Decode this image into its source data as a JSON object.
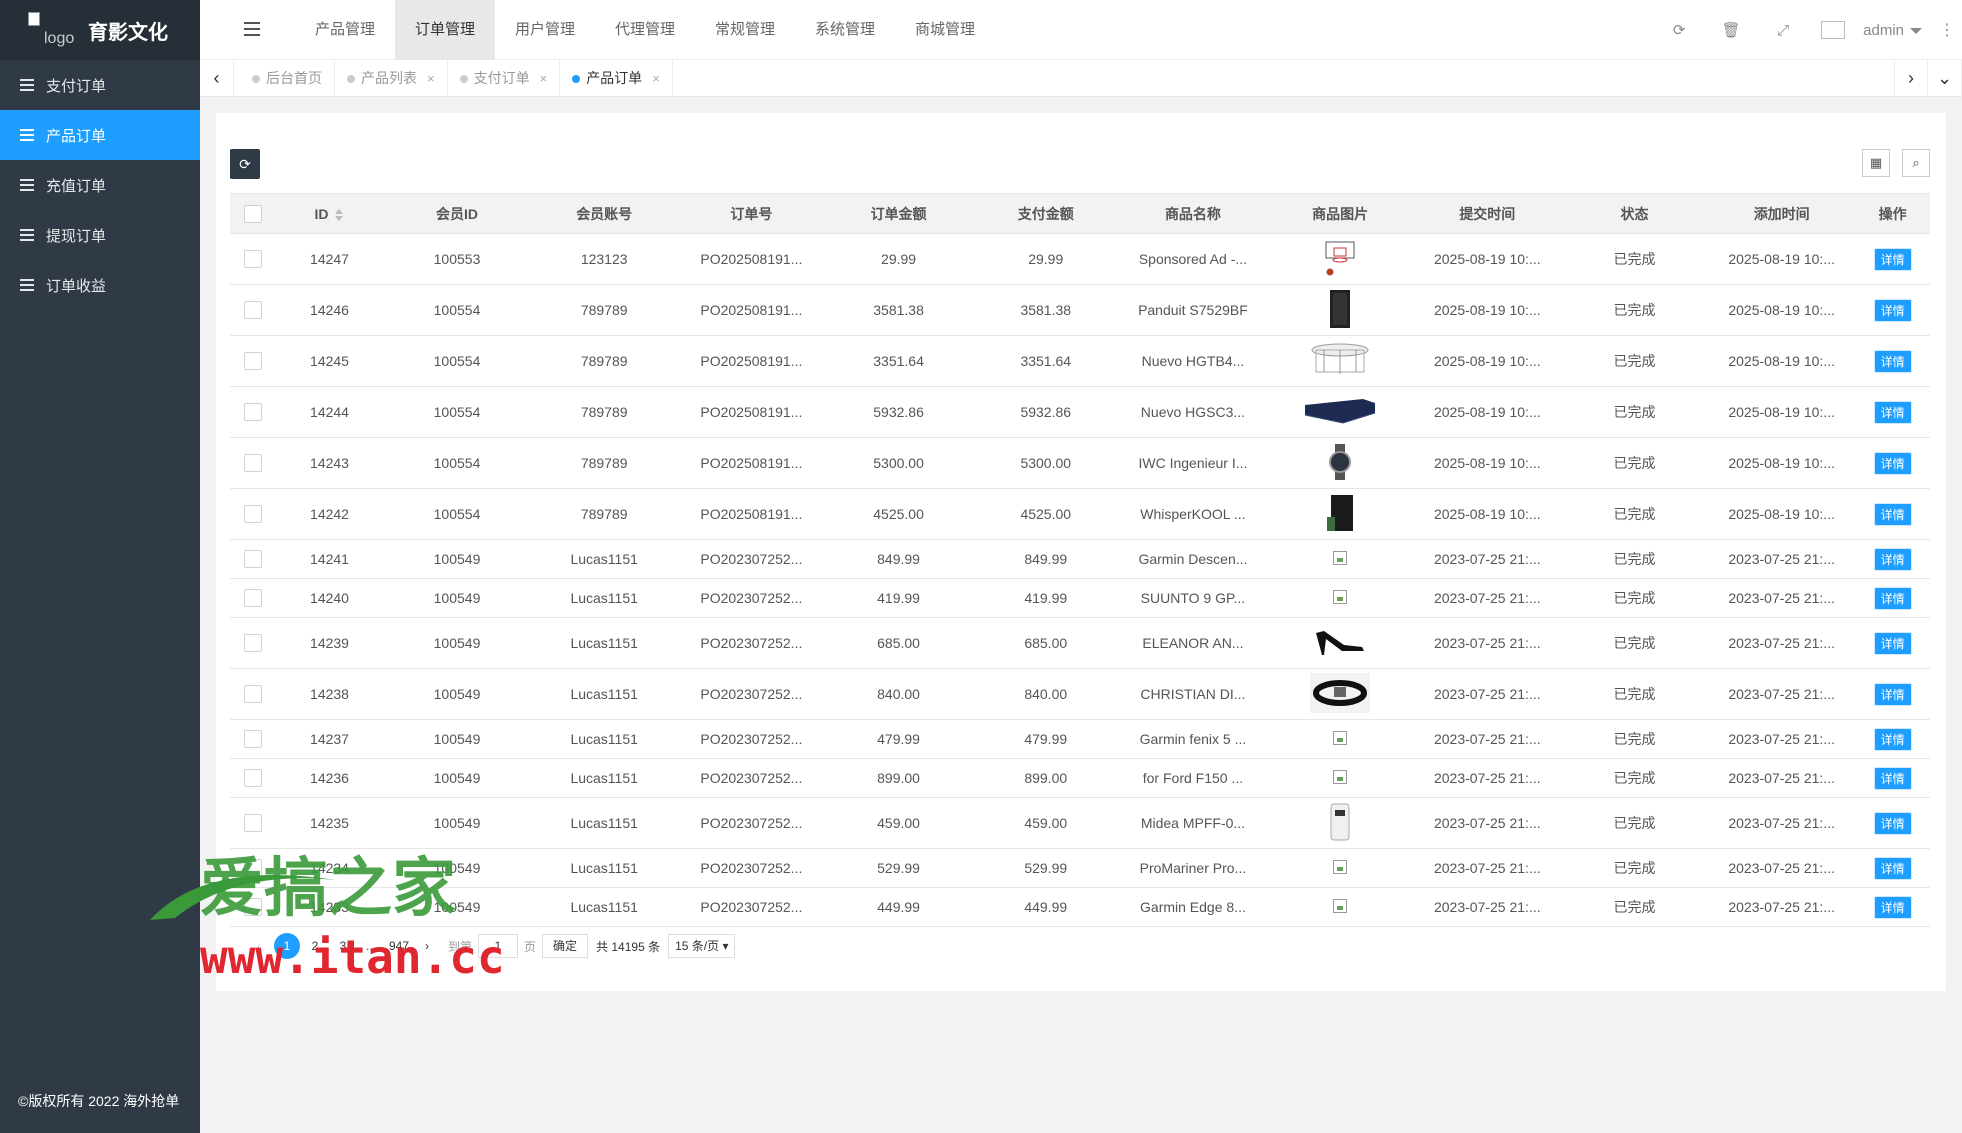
{
  "brand": {
    "logo_alt": "logo",
    "name": "育影文化"
  },
  "sidebar": {
    "items": [
      {
        "label": "支付订单",
        "active": false
      },
      {
        "label": "产品订单",
        "active": true
      },
      {
        "label": "充值订单",
        "active": false
      },
      {
        "label": "提现订单",
        "active": false
      },
      {
        "label": "订单收益",
        "active": false
      }
    ],
    "copyright": "©版权所有 2022 海外抢单"
  },
  "topnav": {
    "items": [
      "产品管理",
      "订单管理",
      "用户管理",
      "代理管理",
      "常规管理",
      "系统管理",
      "商城管理"
    ],
    "active_index": 1
  },
  "header": {
    "user": "admin"
  },
  "tabs": [
    {
      "label": "后台首页",
      "closable": false
    },
    {
      "label": "产品列表",
      "closable": true
    },
    {
      "label": "支付订单",
      "closable": true
    },
    {
      "label": "产品订单",
      "closable": true,
      "active": true
    }
  ],
  "table": {
    "columns": [
      "ID",
      "会员ID",
      "会员账号",
      "订单号",
      "订单金额",
      "支付金额",
      "商品名称",
      "商品图片",
      "提交时间",
      "状态",
      "添加时间",
      "操作"
    ],
    "detail_label": "详情",
    "rows": [
      {
        "id": "14247",
        "member_id": "100553",
        "account": "123123",
        "order_no": "PO202508191...",
        "amount": "29.99",
        "paid": "29.99",
        "product": "Sponsored Ad -...",
        "image": "hoop",
        "submitted": "2025-08-19 10:...",
        "status": "已完成",
        "added": "2025-08-19 10:..."
      },
      {
        "id": "14246",
        "member_id": "100554",
        "account": "789789",
        "order_no": "PO202508191...",
        "amount": "3581.38",
        "paid": "3581.38",
        "product": "Panduit S7529BF",
        "image": "cabinet",
        "submitted": "2025-08-19 10:...",
        "status": "已完成",
        "added": "2025-08-19 10:..."
      },
      {
        "id": "14245",
        "member_id": "100554",
        "account": "789789",
        "order_no": "PO202508191...",
        "amount": "3351.64",
        "paid": "3351.64",
        "product": "Nuevo HGTB4...",
        "image": "table",
        "submitted": "2025-08-19 10:...",
        "status": "已完成",
        "added": "2025-08-19 10:..."
      },
      {
        "id": "14244",
        "member_id": "100554",
        "account": "789789",
        "order_no": "PO202508191...",
        "amount": "5932.86",
        "paid": "5932.86",
        "product": "Nuevo HGSC3...",
        "image": "sofa",
        "submitted": "2025-08-19 10:...",
        "status": "已完成",
        "added": "2025-08-19 10:..."
      },
      {
        "id": "14243",
        "member_id": "100554",
        "account": "789789",
        "order_no": "PO202508191...",
        "amount": "5300.00",
        "paid": "5300.00",
        "product": "IWC Ingenieur I...",
        "image": "watch",
        "submitted": "2025-08-19 10:...",
        "status": "已完成",
        "added": "2025-08-19 10:..."
      },
      {
        "id": "14242",
        "member_id": "100554",
        "account": "789789",
        "order_no": "PO202508191...",
        "amount": "4525.00",
        "paid": "4525.00",
        "product": "WhisperKOOL ...",
        "image": "cooler",
        "submitted": "2025-08-19 10:...",
        "status": "已完成",
        "added": "2025-08-19 10:..."
      },
      {
        "id": "14241",
        "member_id": "100549",
        "account": "Lucas1151",
        "order_no": "PO202307252...",
        "amount": "849.99",
        "paid": "849.99",
        "product": "Garmin Descen...",
        "image": "broken",
        "submitted": "2023-07-25 21:...",
        "status": "已完成",
        "added": "2023-07-25 21:..."
      },
      {
        "id": "14240",
        "member_id": "100549",
        "account": "Lucas1151",
        "order_no": "PO202307252...",
        "amount": "419.99",
        "paid": "419.99",
        "product": "SUUNTO 9 GP...",
        "image": "broken",
        "submitted": "2023-07-25 21:...",
        "status": "已完成",
        "added": "2023-07-25 21:..."
      },
      {
        "id": "14239",
        "member_id": "100549",
        "account": "Lucas1151",
        "order_no": "PO202307252...",
        "amount": "685.00",
        "paid": "685.00",
        "product": "ELEANOR AN...",
        "image": "heels",
        "submitted": "2023-07-25 21:...",
        "status": "已完成",
        "added": "2023-07-25 21:..."
      },
      {
        "id": "14238",
        "member_id": "100549",
        "account": "Lucas1151",
        "order_no": "PO202307252...",
        "amount": "840.00",
        "paid": "840.00",
        "product": "CHRISTIAN DI...",
        "image": "belt",
        "submitted": "2023-07-25 21:...",
        "status": "已完成",
        "added": "2023-07-25 21:..."
      },
      {
        "id": "14237",
        "member_id": "100549",
        "account": "Lucas1151",
        "order_no": "PO202307252...",
        "amount": "479.99",
        "paid": "479.99",
        "product": "Garmin fenix 5 ...",
        "image": "broken",
        "submitted": "2023-07-25 21:...",
        "status": "已完成",
        "added": "2023-07-25 21:..."
      },
      {
        "id": "14236",
        "member_id": "100549",
        "account": "Lucas1151",
        "order_no": "PO202307252...",
        "amount": "899.00",
        "paid": "899.00",
        "product": "for Ford F150 ...",
        "image": "broken",
        "submitted": "2023-07-25 21:...",
        "status": "已完成",
        "added": "2023-07-25 21:..."
      },
      {
        "id": "14235",
        "member_id": "100549",
        "account": "Lucas1151",
        "order_no": "PO202307252...",
        "amount": "459.00",
        "paid": "459.00",
        "product": "Midea MPFF-0...",
        "image": "ac",
        "submitted": "2023-07-25 21:...",
        "status": "已完成",
        "added": "2023-07-25 21:..."
      },
      {
        "id": "14234",
        "member_id": "100549",
        "account": "Lucas1151",
        "order_no": "PO202307252...",
        "amount": "529.99",
        "paid": "529.99",
        "product": "ProMariner Pro...",
        "image": "broken",
        "submitted": "2023-07-25 21:...",
        "status": "已完成",
        "added": "2023-07-25 21:..."
      },
      {
        "id": "14233",
        "member_id": "100549",
        "account": "Lucas1151",
        "order_no": "PO202307252...",
        "amount": "449.99",
        "paid": "449.99",
        "product": "Garmin Edge 8...",
        "image": "broken",
        "submitted": "2023-07-25 21:...",
        "status": "已完成",
        "added": "2023-07-25 21:..."
      }
    ]
  },
  "pagination": {
    "pages": [
      "1",
      "2",
      "3"
    ],
    "ellipsis": "...",
    "last": "947",
    "goto_label": "到第",
    "goto_value": "1",
    "page_unit": "页",
    "confirm": "确定",
    "total": "共 14195 条",
    "per_page": "15 条/页"
  },
  "watermark": {
    "line1": "爱搞之家",
    "line2": "www.itan.cc"
  },
  "colors": {
    "accent": "#1e9fff",
    "sidebar": "#2f3a46",
    "watermark_green": "#3a9a3a",
    "watermark_red": "#e0262f"
  }
}
